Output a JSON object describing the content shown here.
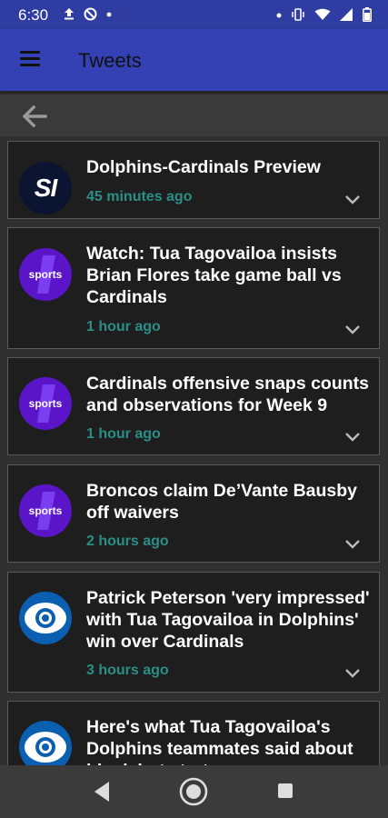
{
  "status_bar": {
    "time": "6:30",
    "left_icons": [
      "upload-icon",
      "do-not-disturb-icon",
      "dot-icon"
    ],
    "right_icons": [
      "dot-icon",
      "vibrate-icon",
      "wifi-icon",
      "signal-icon",
      "battery-icon"
    ]
  },
  "app_bar": {
    "title": "Tweets"
  },
  "back_bar": {
    "back_icon": "back-arrow-icon"
  },
  "feed": {
    "items": [
      {
        "source_logo": "SI",
        "logo_type": "si",
        "headline": "Dolphins-Cardinals Preview",
        "time": "45 minutes ago"
      },
      {
        "source_logo": "sports",
        "logo_type": "yahoo-sports",
        "headline": "Watch: Tua Tagovailoa insists Brian Flores take game ball vs Cardinals",
        "time": "1 hour ago"
      },
      {
        "source_logo": "sports",
        "logo_type": "yahoo-sports",
        "headline": "Cardinals offensive snaps counts and observations for Week 9",
        "time": "1 hour ago"
      },
      {
        "source_logo": "sports",
        "logo_type": "yahoo-sports",
        "headline": "Broncos claim De’Vante Bausby off waivers",
        "time": "2 hours ago"
      },
      {
        "source_logo": "cbs-eye",
        "logo_type": "cbs",
        "headline": "Patrick Peterson 'very impressed' with Tua Tagovailoa in Dolphins' win over Cardinals",
        "time": "3 hours ago"
      },
      {
        "source_logo": "cbs-eye",
        "logo_type": "cbs",
        "headline": "Here's what Tua Tagovailoa's Dolphins teammates said about his debut start...",
        "time": ""
      }
    ]
  },
  "nav_bar": {
    "buttons": [
      "back-triangle-icon",
      "home-circle-icon",
      "recents-square-icon"
    ]
  },
  "colors": {
    "primary": "#3341b5",
    "status_bar": "#2f3da3",
    "card_bg": "#1e1e1e",
    "time_text": "#2a8f86",
    "yahoo_purple": "#5b15c8",
    "cbs_blue": "#0a5fb0"
  }
}
